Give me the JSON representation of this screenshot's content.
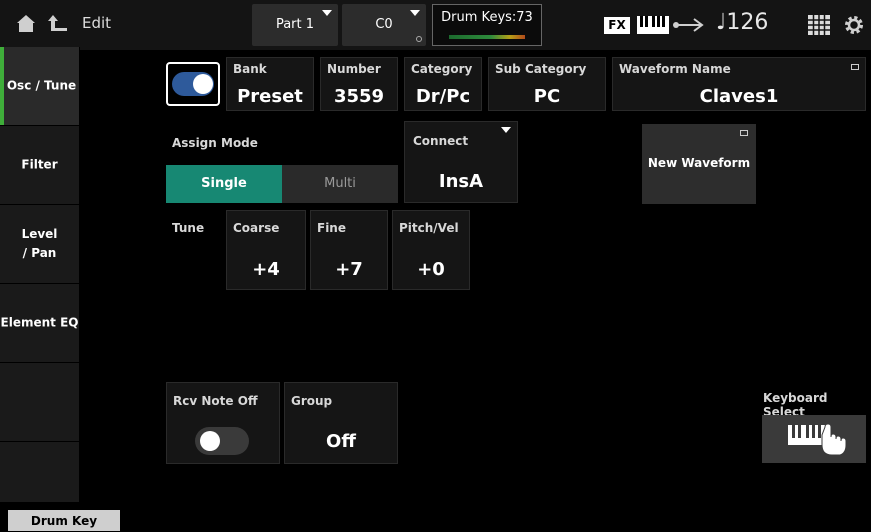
{
  "topbar": {
    "edit_label": "Edit",
    "part_label": "Part 1",
    "note_label": "C0",
    "drum_keys_label": "Drum Keys:73",
    "fx_label": "FX",
    "tempo_label": "♩126"
  },
  "sidebar": {
    "items": [
      {
        "label": "Osc / Tune"
      },
      {
        "label": "Filter"
      },
      {
        "label": "Level\n/ Pan"
      },
      {
        "label": "Element EQ"
      }
    ],
    "bottom_tab": "Drum Key"
  },
  "osc": {
    "bank_label": "Bank",
    "bank_value": "Preset",
    "number_label": "Number",
    "number_value": "3559",
    "category_label": "Category",
    "category_value": "Dr/Pc",
    "subcategory_label": "Sub Category",
    "subcategory_value": "PC",
    "waveform_label": "Waveform Name",
    "waveform_value": "Claves1"
  },
  "assign": {
    "label": "Assign Mode",
    "single": "Single",
    "multi": "Multi",
    "connect_label": "Connect",
    "connect_value": "InsA",
    "new_waveform": "New Waveform"
  },
  "tune": {
    "label": "Tune",
    "coarse_label": "Coarse",
    "coarse_value": "+4",
    "fine_label": "Fine",
    "fine_value": "+7",
    "pitchvel_label": "Pitch/Vel",
    "pitchvel_value": "+0"
  },
  "bottom": {
    "rcv_label": "Rcv Note Off",
    "group_label": "Group",
    "group_value": "Off",
    "keyboard_select_label": "Keyboard Select"
  }
}
